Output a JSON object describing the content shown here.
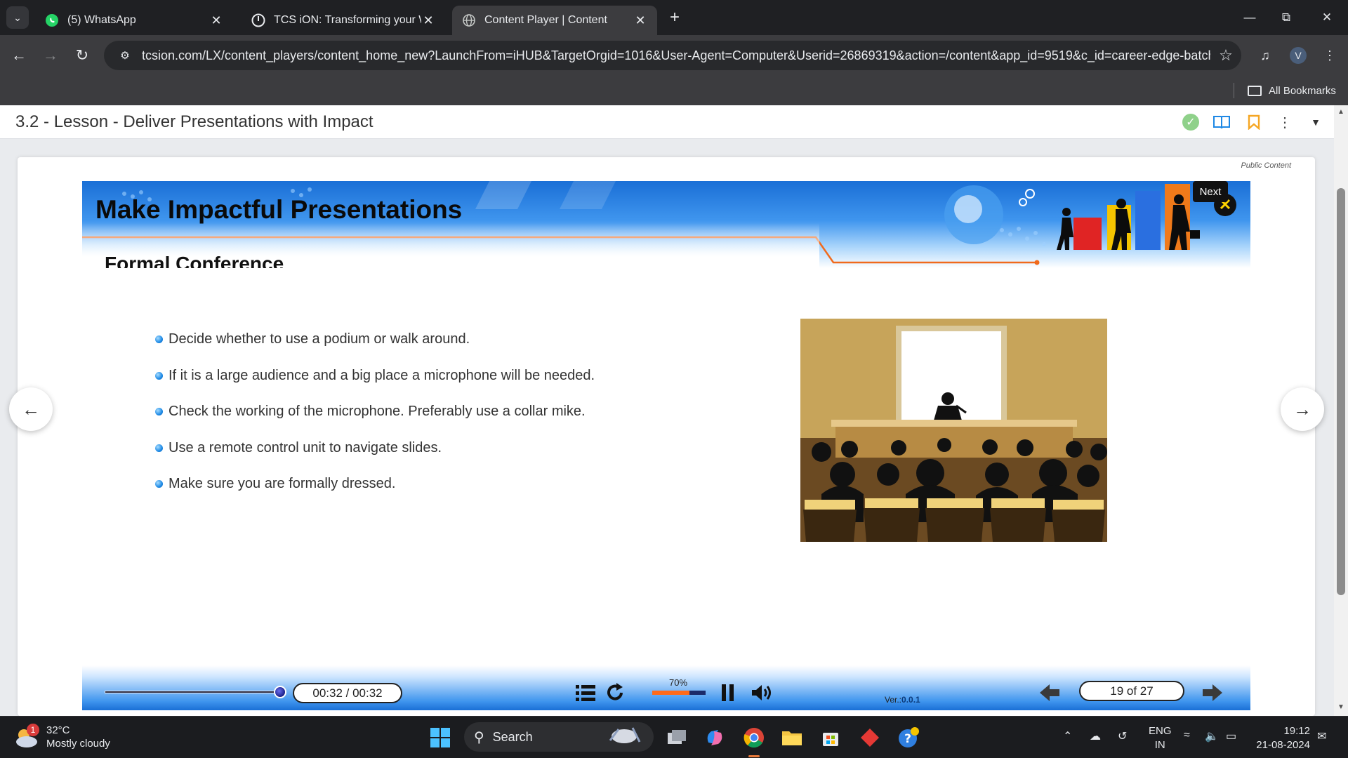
{
  "browser": {
    "tabs": [
      {
        "title": "(5) WhatsApp",
        "icon": "whatsapp-icon"
      },
      {
        "title": "TCS iON: Transforming your Wo",
        "icon": "tcs-ion-icon"
      },
      {
        "title": "Content Player | Content",
        "icon": "globe-icon"
      }
    ],
    "url": "tcsion.com/LX/content_players/content_home_new?LaunchFrom=iHUB&TargetOrgid=1016&User-Agent=Computer&Userid=26869319&action=/content&app_id=9519&c_id=career-edge-batch...",
    "profile_initial": "V",
    "bookmarks_label": "All Bookmarks"
  },
  "lesson": {
    "title": "3.2 - Lesson - Deliver Presentations with Impact",
    "public_label": "Public Content"
  },
  "slide": {
    "banner_title": "Make Impactful Presentations",
    "subtitle": "Formal Conference",
    "bullets": [
      "Decide whether to use a podium or walk around.",
      "If it is a large audience and a big place a microphone will be needed.",
      "Check the working of the microphone. Preferably use a collar mike.",
      "Use a remote control unit to navigate slides.",
      "Make sure you are formally dressed."
    ]
  },
  "player": {
    "time": "00:32 / 00:32",
    "seek_fraction": 1.0,
    "volume_label": "70%",
    "volume_fraction": 0.7,
    "version_prefix": "Ver.:",
    "version": "0.0.1",
    "page_indicator": "19 of 27",
    "next_tooltip": "Next"
  },
  "taskbar": {
    "weather_temp": "32°C",
    "weather_desc": "Mostly cloudy",
    "weather_badge": "1",
    "search_label": "Search",
    "lang_line1": "ENG",
    "lang_line2": "IN",
    "time": "19:12",
    "date": "21-08-2024"
  },
  "colors": {
    "accent_blue": "#1a6fd6",
    "volume_orange": "#ff6a1a",
    "bookmark_orange": "#f5a623",
    "check_green": "#8fd18a"
  }
}
